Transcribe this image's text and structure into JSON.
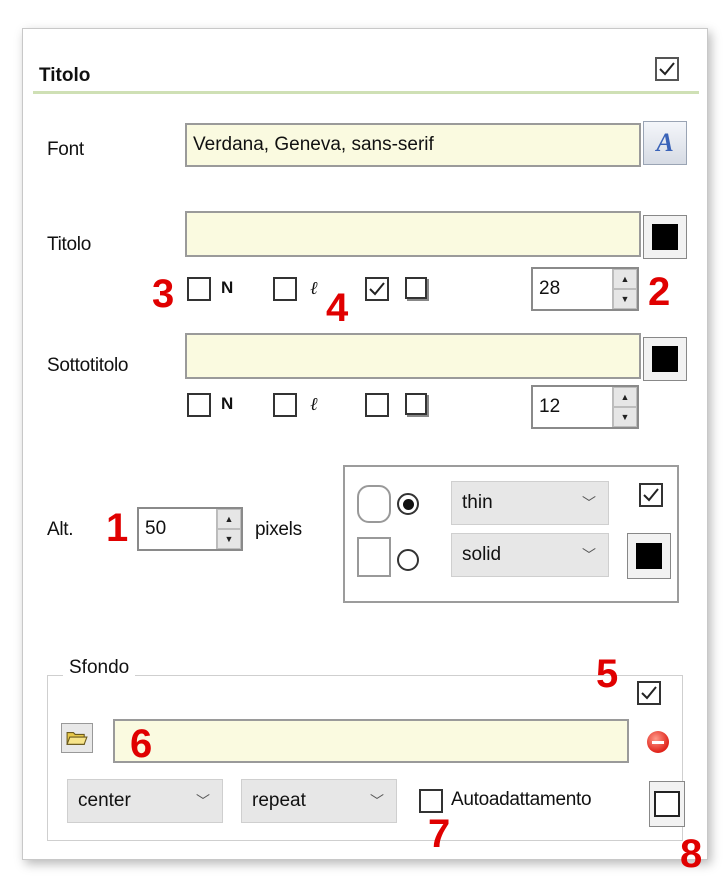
{
  "header": {
    "title": "Titolo",
    "enabled": true
  },
  "font": {
    "label": "Font",
    "value": "Verdana, Geneva, sans-serif",
    "icon": "font-picker-icon"
  },
  "title_section": {
    "label": "Titolo",
    "value": "",
    "color": "#000000",
    "bold_label": "N",
    "italic_label": "ℓ",
    "bold": false,
    "italic": false,
    "shadow_check": true,
    "size": "28"
  },
  "subtitle_section": {
    "label": "Sottotitolo",
    "value": "",
    "color": "#000000",
    "bold_label": "N",
    "italic_label": "ℓ",
    "bold": false,
    "italic": false,
    "shadow_check": false,
    "size": "12"
  },
  "height": {
    "label": "Alt.",
    "value": "50",
    "unit": "pixels"
  },
  "border": {
    "width_value": "thin",
    "style_value": "solid",
    "enabled": true,
    "color": "#000000",
    "rounded_selected": true
  },
  "background": {
    "group_title": "Sfondo",
    "enabled": true,
    "image_path": "",
    "position_value": "center",
    "repeat_value": "repeat",
    "autofit_label": "Autoadattamento",
    "autofit": false
  },
  "annotations": [
    "1",
    "2",
    "3",
    "4",
    "5",
    "6",
    "7",
    "8"
  ],
  "colors": {
    "accent_line": "#cfe0b5",
    "field_bg": "#fafae0",
    "annotation": "#e00000"
  }
}
